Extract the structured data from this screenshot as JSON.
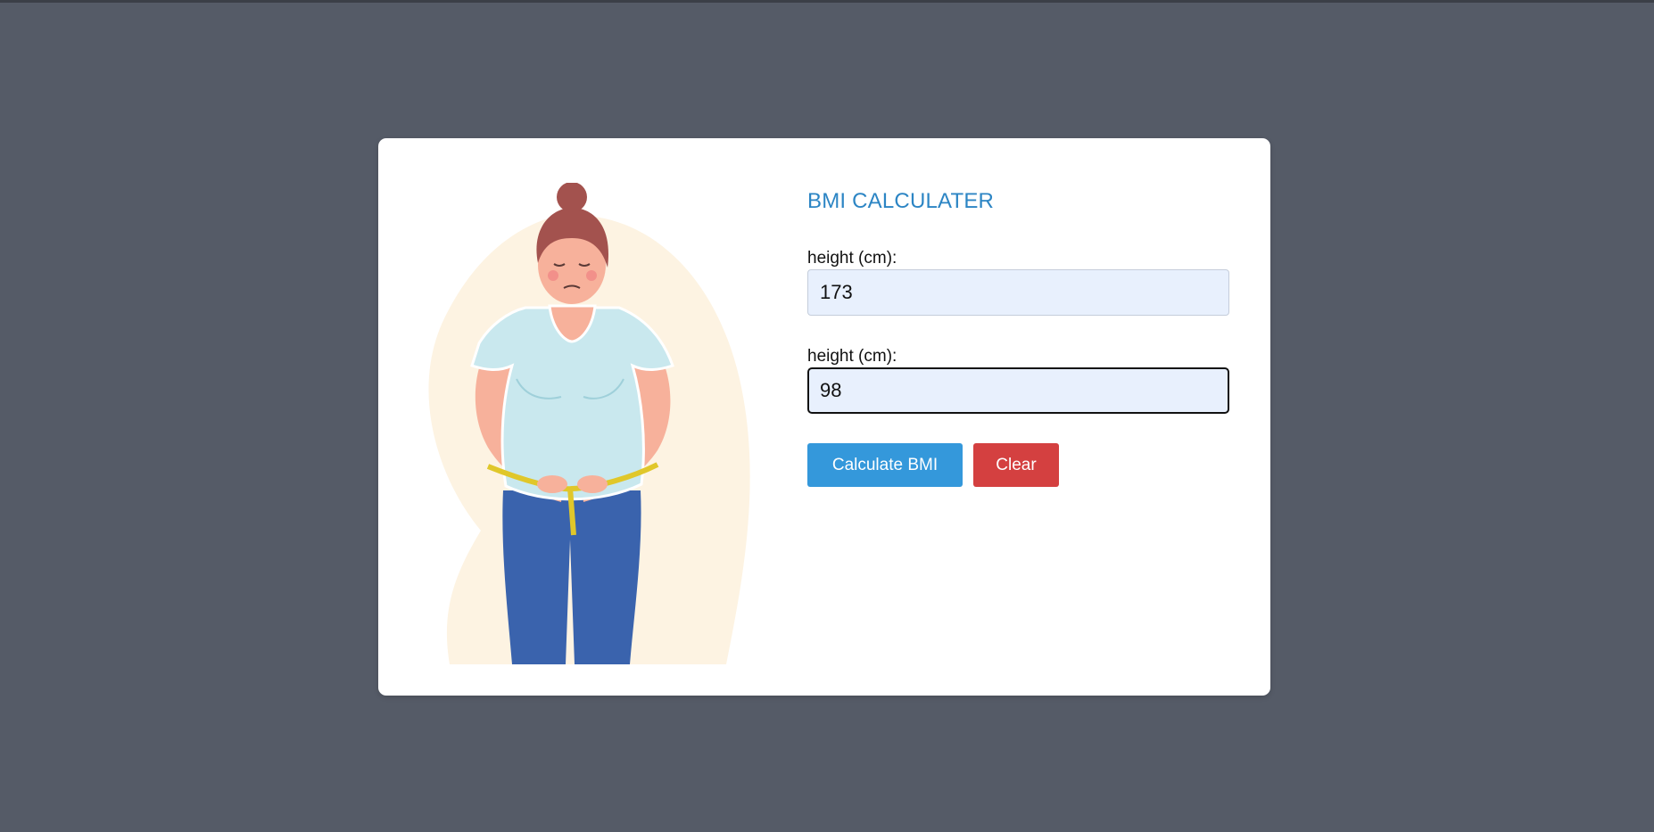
{
  "app": {
    "title": "BMI CALCULATER"
  },
  "form": {
    "height_label": "height (cm):",
    "height_value": "173",
    "weight_label": "height (cm):",
    "weight_value": "98"
  },
  "buttons": {
    "calculate_label": "Calculate BMI",
    "clear_label": "Clear"
  },
  "illustration": {
    "icon": "woman-measuring-waist-illustration"
  },
  "colors": {
    "background": "#555b67",
    "card": "#ffffff",
    "title": "#2c85c4",
    "input_bg": "#e8f0fd",
    "calculate_button": "#3498db",
    "clear_button": "#d44040"
  }
}
